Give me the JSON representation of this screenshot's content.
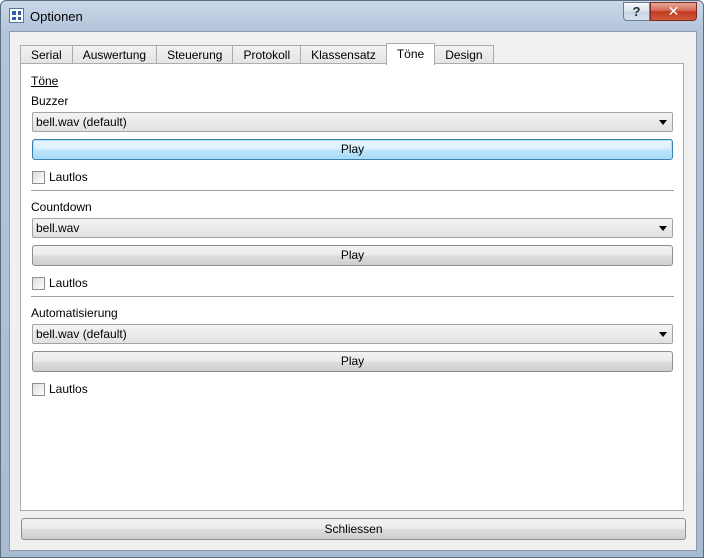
{
  "window": {
    "title": "Optionen",
    "help_label": "?",
    "close_label": "✕"
  },
  "tabs": [
    {
      "label": "Serial"
    },
    {
      "label": "Auswertung"
    },
    {
      "label": "Steuerung"
    },
    {
      "label": "Protokoll"
    },
    {
      "label": "Klassensatz"
    },
    {
      "label": "Töne",
      "active": true
    },
    {
      "label": "Design"
    }
  ],
  "panel": {
    "heading": "Töne",
    "sections": [
      {
        "label": "Buzzer",
        "selected_sound": "bell.wav (default)",
        "play_label": "Play",
        "mute_label": "Lautlos",
        "muted": false
      },
      {
        "label": "Countdown",
        "selected_sound": "bell.wav",
        "play_label": "Play",
        "mute_label": "Lautlos",
        "muted": false
      },
      {
        "label": "Automatisierung",
        "selected_sound": "bell.wav (default)",
        "play_label": "Play",
        "mute_label": "Lautlos",
        "muted": false
      }
    ]
  },
  "footer": {
    "close_label": "Schliessen"
  }
}
